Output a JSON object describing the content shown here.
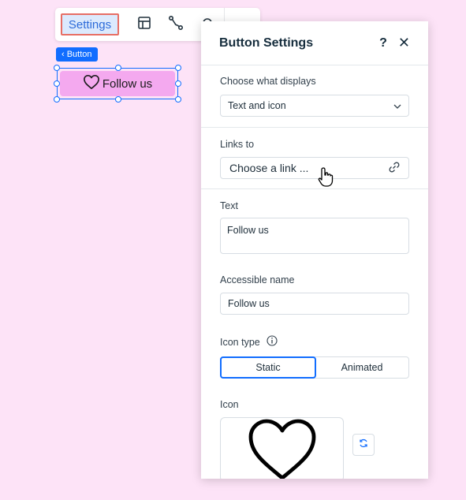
{
  "toolbar": {
    "settings_label": "Settings",
    "icons": [
      "layout-icon",
      "connect-icon",
      "more-icon"
    ]
  },
  "element_tag": {
    "label": "‹ Button"
  },
  "canvas_button": {
    "icon": "heart-icon",
    "label": "Follow us"
  },
  "panel": {
    "title": "Button Settings",
    "help": "?",
    "close": "✕",
    "display": {
      "label": "Choose what displays",
      "value": "Text and icon"
    },
    "links": {
      "label": "Links to",
      "value": "Choose a link ...",
      "icon": "link-icon"
    },
    "text": {
      "label": "Text",
      "value": "Follow us"
    },
    "accessible": {
      "label": "Accessible name",
      "value": "Follow us"
    },
    "icon_type": {
      "label": "Icon type",
      "options": [
        "Static",
        "Animated"
      ],
      "selected": "Static"
    },
    "icon": {
      "label": "Icon",
      "preview": "heart-icon",
      "replace_icon": "refresh-icon"
    }
  },
  "colors": {
    "accent": "#116dff",
    "canvas": "#fde3f7",
    "button_fill": "#f4a9ef",
    "highlight": "#e76e64"
  }
}
